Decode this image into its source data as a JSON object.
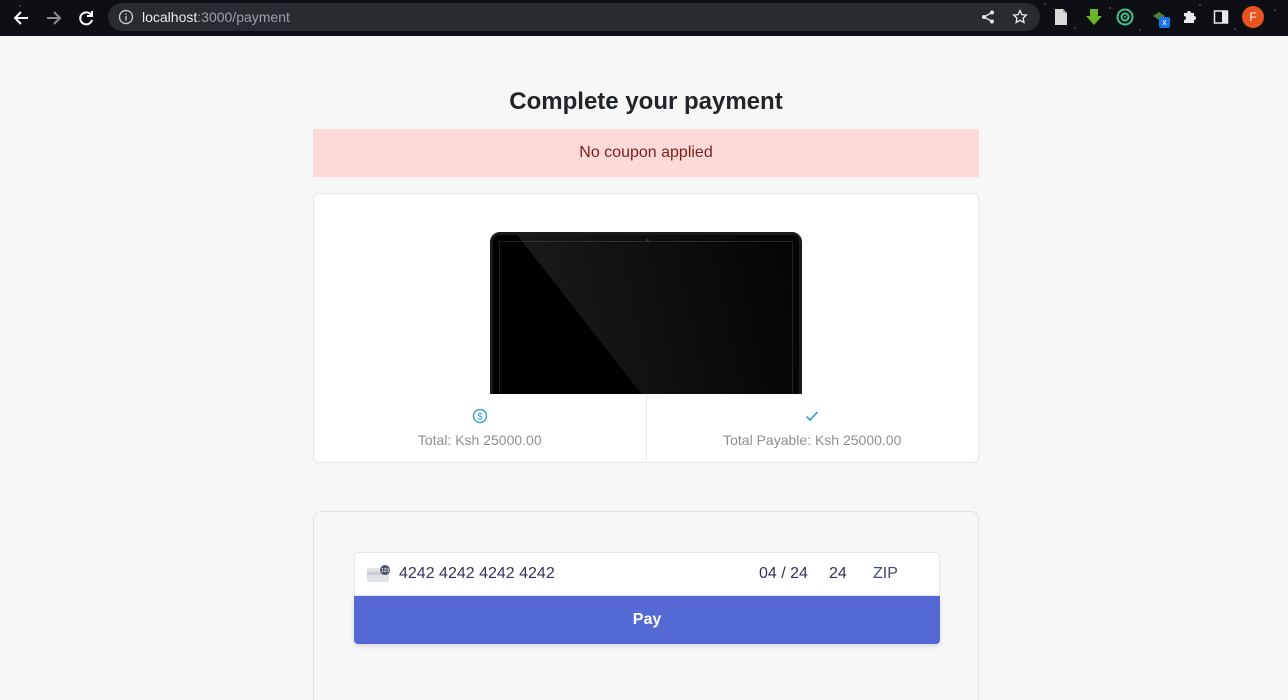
{
  "browser": {
    "url_host": "localhost",
    "url_path": ":3000/payment",
    "profile_initial": "F",
    "extension_badge": "x"
  },
  "page": {
    "title": "Complete your payment",
    "coupon_alert": "No coupon applied"
  },
  "summary": {
    "total_label": "Total: Ksh 25000.00",
    "payable_label": "Total Payable: Ksh 25000.00"
  },
  "payment": {
    "card_number": "4242 4242 4242 4242",
    "expiry": "04 / 24",
    "cvc": "24",
    "zip_placeholder": "ZIP",
    "pay_label": "Pay"
  },
  "colors": {
    "alert_bg": "#fdd9d7",
    "alert_text": "#7f1d1d",
    "pay_button": "#5469d4",
    "icon_accent": "#1e9ad6"
  }
}
